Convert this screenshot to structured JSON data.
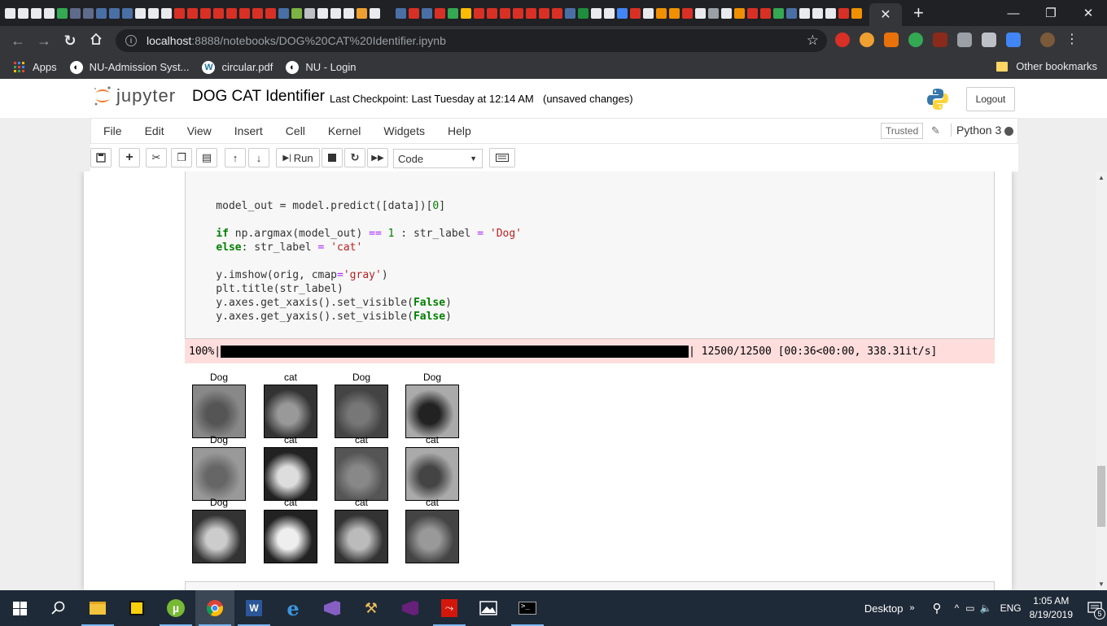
{
  "browser": {
    "tab_close_glyph": "✕",
    "new_tab_glyph": "+",
    "window_controls": [
      "—",
      "❐",
      "✕"
    ],
    "url_host": "localhost",
    "url_path": ":8888/notebooks/DOG%20CAT%20Identifier.ipynb",
    "bookmarks": [
      {
        "label": "Apps",
        "icon": "apps-grid-icon"
      },
      {
        "label": "NU-Admission Syst...",
        "icon": "globe-icon"
      },
      {
        "label": "circular.pdf",
        "icon": "wordpress-icon"
      },
      {
        "label": "NU - Login",
        "icon": "globe-icon"
      }
    ],
    "other_bookmarks": "Other bookmarks"
  },
  "jupyter": {
    "logo_text": "jupyter",
    "notebook_name": "DOG CAT Identifier",
    "checkpoint": "Last Checkpoint: Last Tuesday at 12:14 AM",
    "unsaved": "(unsaved changes)",
    "logout": "Logout",
    "menu": [
      "File",
      "Edit",
      "View",
      "Insert",
      "Cell",
      "Kernel",
      "Widgets",
      "Help"
    ],
    "trusted": "Trusted",
    "kernel": "Python 3",
    "run_label": "Run",
    "cell_type": "Code"
  },
  "cell": {
    "output_prefix": "100%|",
    "output_suffix": "| 12500/12500 [00:36<00:00, 338.31it/s]",
    "progress_fraction": 1.0
  },
  "figure": {
    "titles": [
      "Dog",
      "cat",
      "Dog",
      "Dog",
      "Dog",
      "cat",
      "cat",
      "cat",
      "Dog",
      "cat",
      "cat",
      "cat"
    ]
  },
  "taskbar": {
    "desktop": "Desktop",
    "language": "ENG",
    "time": "1:05 AM",
    "date": "8/19/2019",
    "notifications": "5"
  }
}
